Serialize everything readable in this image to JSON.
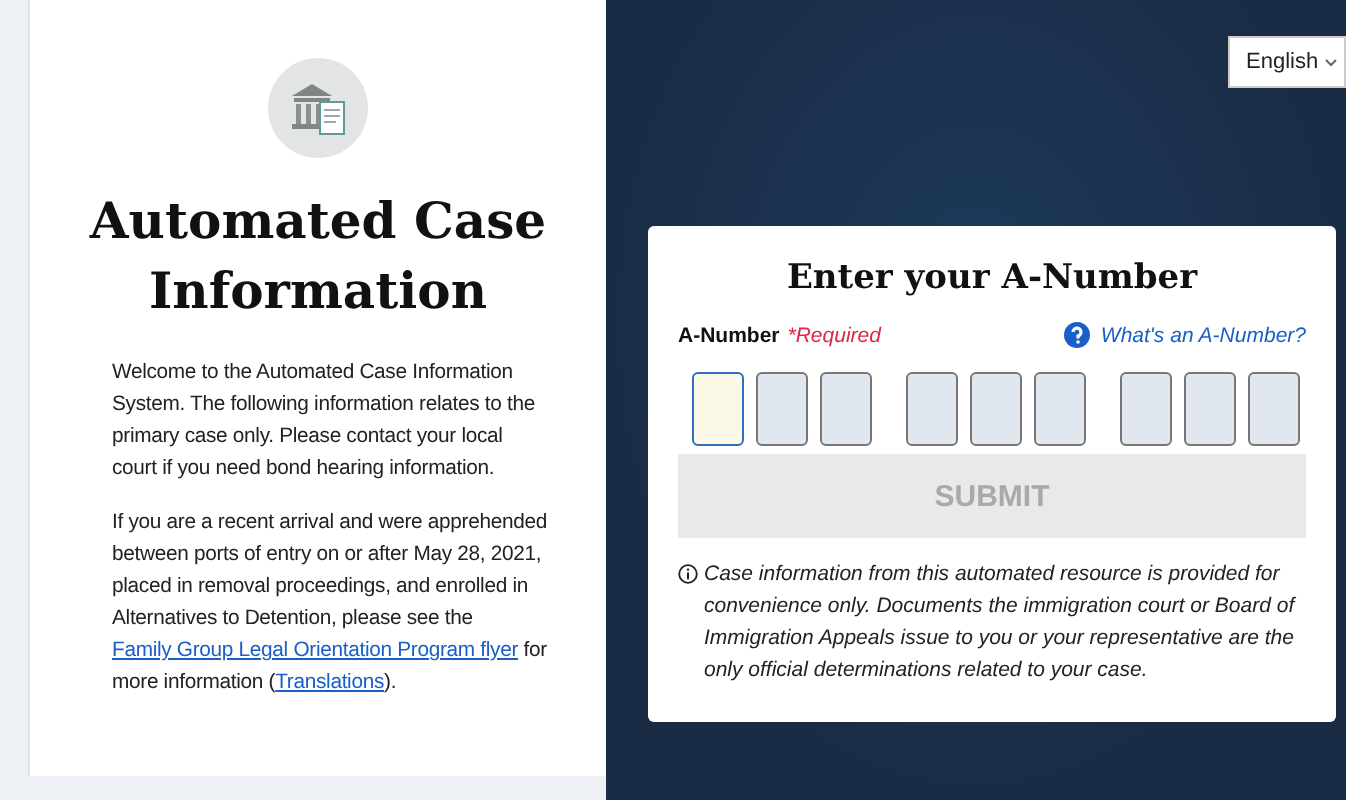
{
  "intro": {
    "title": "Automated Case Information",
    "paragraphs": [
      [
        {
          "text": "Welcome to the Automated Case Information System. The following information relates to the primary case only. Please contact your local court if you need bond hearing information.",
          "link": false
        }
      ],
      [
        {
          "text": "If you are a recent arrival and were apprehended between ports of entry on or after May 28, 2021, placed in removal proceedings, and enrolled in Alternatives to Detention, please see the ",
          "link": false
        },
        {
          "text": "Family Group Legal Orientation Program flyer",
          "link": true
        },
        {
          "text": " for more information (",
          "link": false
        },
        {
          "text": "Translations",
          "link": true
        },
        {
          "text": ").",
          "link": false
        }
      ]
    ]
  },
  "language_select": {
    "value": "English"
  },
  "form": {
    "title": "Enter your A-Number",
    "label": "A-Number",
    "required": "*Required",
    "help_link": "What's an A-Number?",
    "digit_groups": [
      [
        {
          "focused": true
        },
        {
          "focused": false
        },
        {
          "focused": false
        }
      ],
      [
        {
          "focused": false
        },
        {
          "focused": false
        },
        {
          "focused": false
        }
      ],
      [
        {
          "focused": false
        },
        {
          "focused": false
        },
        {
          "focused": false
        }
      ]
    ],
    "submit": {
      "label": "SUBMIT",
      "disabled": true
    },
    "note": "Case information from this automated resource is provided for convenience only. Documents the immigration court or Board of Immigration Appeals issue to you or your representative are the only official determinations related to your case."
  }
}
